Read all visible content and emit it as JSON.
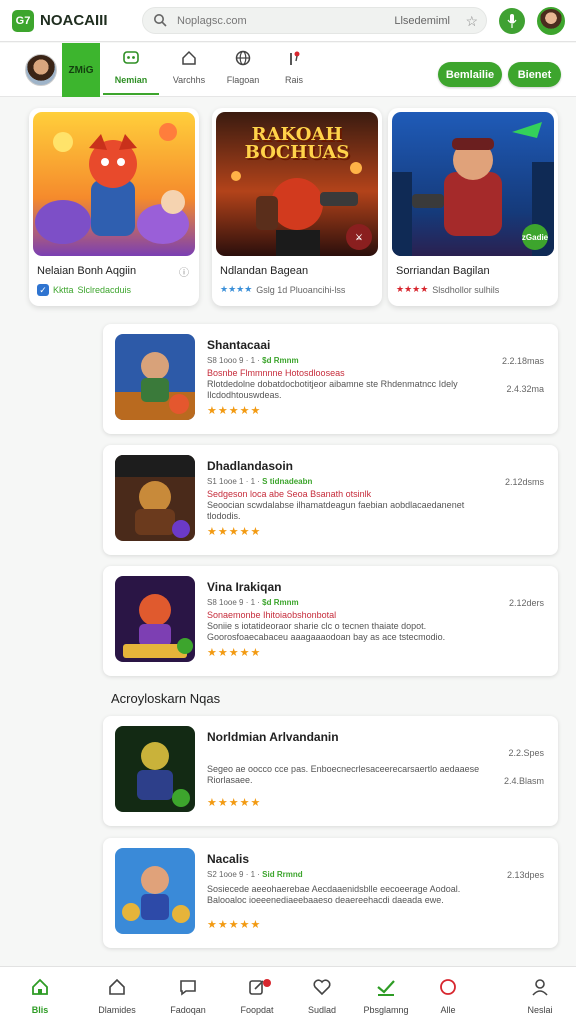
{
  "app": {
    "logo_badge": "G7",
    "title": "NOACAIII"
  },
  "search": {
    "placeholder": "Noplagsc.com",
    "right_label": "Llsedemiml",
    "star_icon": "star-icon"
  },
  "header": {
    "mic_icon": "microphone-icon",
    "avatar_icon": "avatar"
  },
  "nav": {
    "green_label": "ZMiG",
    "tabs": [
      {
        "icon": "gamepad-icon",
        "label": "Nemian",
        "active": true
      },
      {
        "icon": "home-icon",
        "label": "Varchhs",
        "active": false
      },
      {
        "icon": "globe-icon",
        "label": "Flagoan",
        "active": false
      },
      {
        "icon": "pin-icon",
        "label": "Rais",
        "active": false
      }
    ],
    "pill_buttons": [
      "Bemlailie",
      "Bienet"
    ]
  },
  "featured": [
    {
      "title": "Nelaian Bonh Aqgiin",
      "meta_green": "Kktta",
      "meta_text": "Slclredacduis",
      "check": "✓",
      "info": "ⓘ"
    },
    {
      "title": "Ndlandan Bagean",
      "art_title_line1": "RAKOAH",
      "art_title_line2": "BOCHUAS",
      "stars": "★★★★",
      "meta_text": "Gslg 1d Pluoancihi-lss"
    },
    {
      "title": "Sorriandan Bagilan",
      "stars": "★★★★",
      "meta_text": "Slsdhollor sulhils",
      "badge": "zGadie"
    }
  ],
  "list": [
    {
      "title": "Shantacaai",
      "meta": "S8 1ooo 9 · 1 ·",
      "meta_green": "$d Rmnm",
      "highlight": "Bosnbe  Flmmnnne Hotosdlooseas",
      "desc": "Rlotdedolne dobatdocbotitjeor aibamne ste Rhdenmatncc Idely Ilcdodhtouswdeas.",
      "stars": "★★★★★",
      "right1": "2.2.18mas",
      "right2": "2.4.32ma"
    },
    {
      "title": "Dhadlandasoin",
      "meta": "S1 1ooe 1 · 1 ·",
      "meta_green": "S tidnadeabn",
      "highlight": "Sedgeson loca abe Seoa Bsanath otsinlk",
      "desc": "Seoocian scwdalabse ilhamatdeagun faebian aobdlacaedanenet tlododis.",
      "stars": "★★★★★",
      "right1": "2.12dsms",
      "right2": ""
    },
    {
      "title": "Vina Irakiqan",
      "meta": "S8 1ooe 9 · 1 ·",
      "meta_green": "$d Rmnm",
      "highlight": "Sonaemonbe  Ihitoiaobshonbotal",
      "desc": "Soniie s iotatideoraor sharie clc o tecnen thaiate dopot. Goorosfoaecabaceu aaagaaaodoan bay as ace tstecmodio.",
      "stars": "★★★★★",
      "right1": "2.12ders",
      "right2": ""
    },
    {
      "title": "Norldmian Arlvandanin",
      "meta": "",
      "meta_green": "",
      "highlight": "",
      "desc": "Segeo ae oocco cce pas. Enboecnecrlesaceerecarsaertlo aedaaese Riorlasaee.",
      "stars": "★★★★★",
      "right1": "2.2.Spes",
      "right2": "2.4.Blasm"
    },
    {
      "title": "Nacalis",
      "meta": "S2 1ooe 9 · 1 ·",
      "meta_green": "Sid Rrmnd",
      "highlight": "",
      "desc": "Sosiecede aeeohaerebae Aecdaaenidsblle eecoeerage Aodoal. Balooaloc ioeeenediaeebaaeso deaereehacdi daeada ewe.",
      "stars": "★★★★★",
      "right1": "2.13dpes",
      "right2": ""
    }
  ],
  "section_title": "Acroyloskarn Nqas",
  "bottom_nav": [
    {
      "icon": "home-icon",
      "label": "Blis",
      "active": true
    },
    {
      "icon": "house-icon",
      "label": "Dlamides",
      "active": false
    },
    {
      "icon": "chat-icon",
      "label": "Fadoqan",
      "active": false
    },
    {
      "icon": "edit-icon",
      "label": "Foopdat",
      "active": false
    },
    {
      "icon": "heart-icon",
      "label": "Sudlad",
      "active": false
    },
    {
      "icon": "check-icon",
      "label": "Pbsglamng",
      "active": false
    },
    {
      "icon": "circle-icon",
      "label": "Alle",
      "active": false
    },
    {
      "icon": "user-icon",
      "label": "Neslai",
      "active": false
    }
  ]
}
